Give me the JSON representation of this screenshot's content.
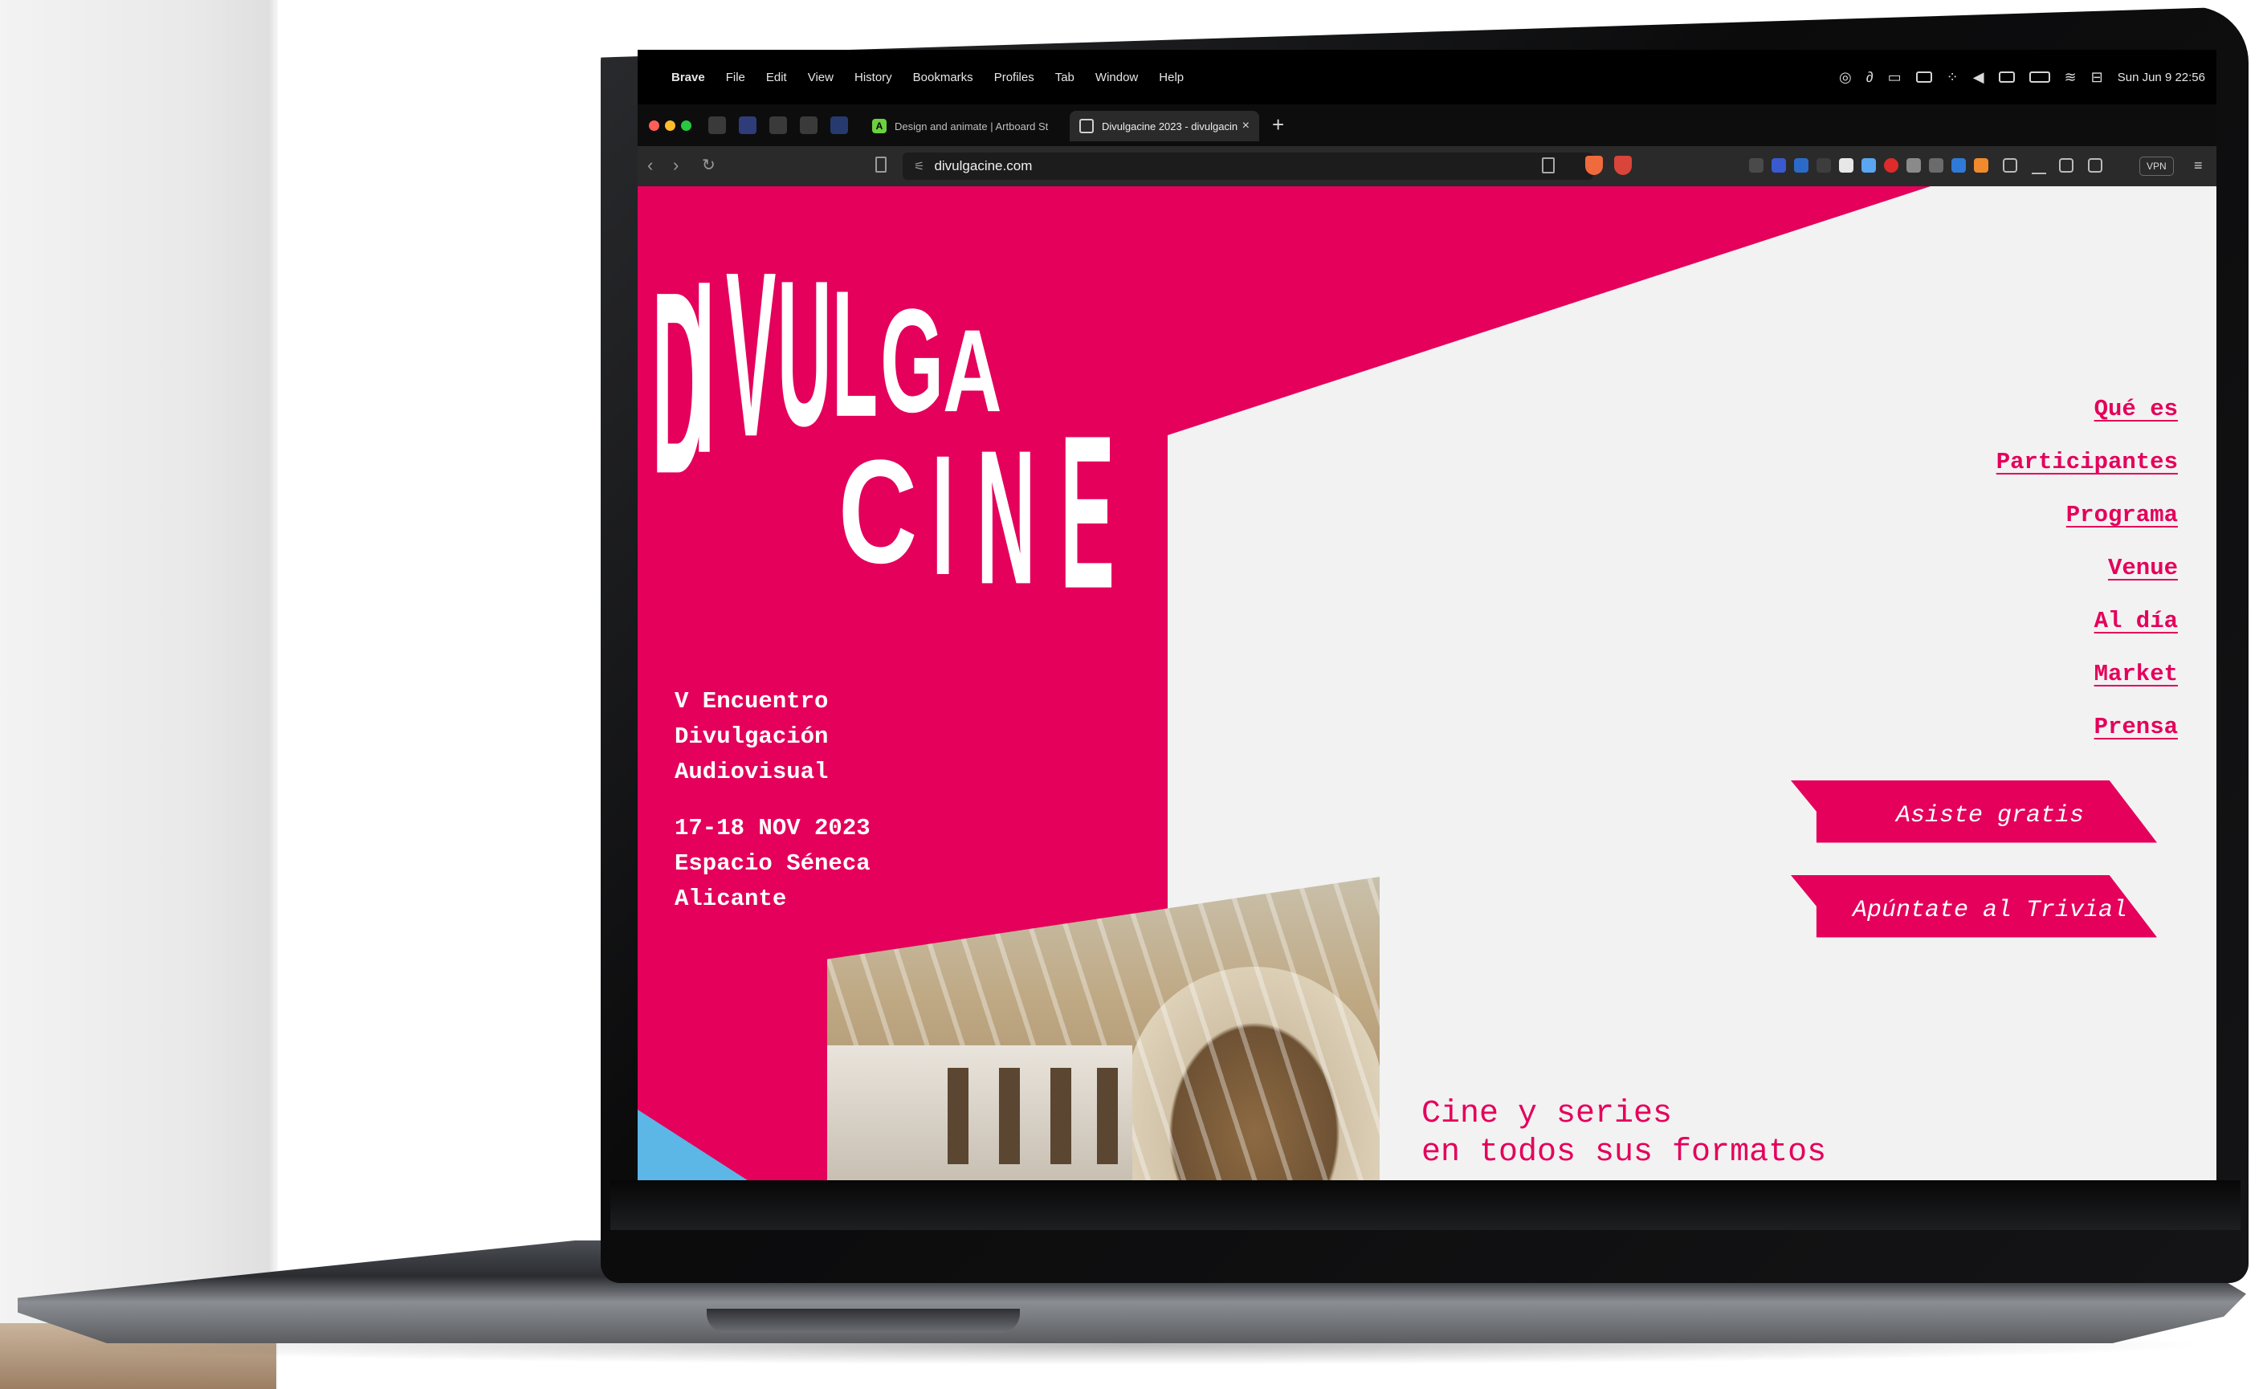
{
  "menubar": {
    "apple_glyph": "",
    "app": "Brave",
    "items": [
      "File",
      "Edit",
      "View",
      "History",
      "Bookmarks",
      "Profiles",
      "Tab",
      "Window",
      "Help"
    ],
    "clock": "Sun Jun 9  22:56"
  },
  "tabs": {
    "inactive_title": "Design and animate | Artboard St",
    "active_title": "Divulgacine 2023 - divulgacin",
    "close_glyph": "×",
    "new_tab_glyph": "+"
  },
  "toolbar": {
    "url": "divulgacine.com",
    "vpn_label": "VPN",
    "back_glyph": "‹",
    "forward_glyph": "›",
    "reload_glyph": "↻",
    "menu_glyph": "≡"
  },
  "site": {
    "logo_line1": [
      "D",
      "I",
      "V",
      "U",
      "L",
      "G",
      "A"
    ],
    "logo_line2": [
      "C",
      "I",
      "N",
      "E"
    ],
    "event_lines_1": [
      "V Encuentro",
      "Divulgación",
      "Audiovisual"
    ],
    "event_lines_2": [
      "17-18 NOV 2023",
      "Espacio Séneca",
      "Alicante"
    ],
    "nav": [
      "Qué es",
      "Participantes",
      "Programa",
      "Venue",
      "Al día",
      "Market",
      "Prensa"
    ],
    "cta_primary": "Asiste gratis",
    "cta_secondary": "Apúntate al Trivial",
    "tagline_1": "Cine y series",
    "tagline_2": "en todos sus formatos"
  },
  "colors": {
    "brand_pink": "#e4005b",
    "page_bg": "#f2f2f2",
    "menubar_bg": "#000000"
  },
  "icons": [
    "apple-icon",
    "bookmark-icon",
    "share-icon",
    "brave-shield-icon",
    "wifi-icon",
    "battery-icon",
    "menu-icon"
  ]
}
